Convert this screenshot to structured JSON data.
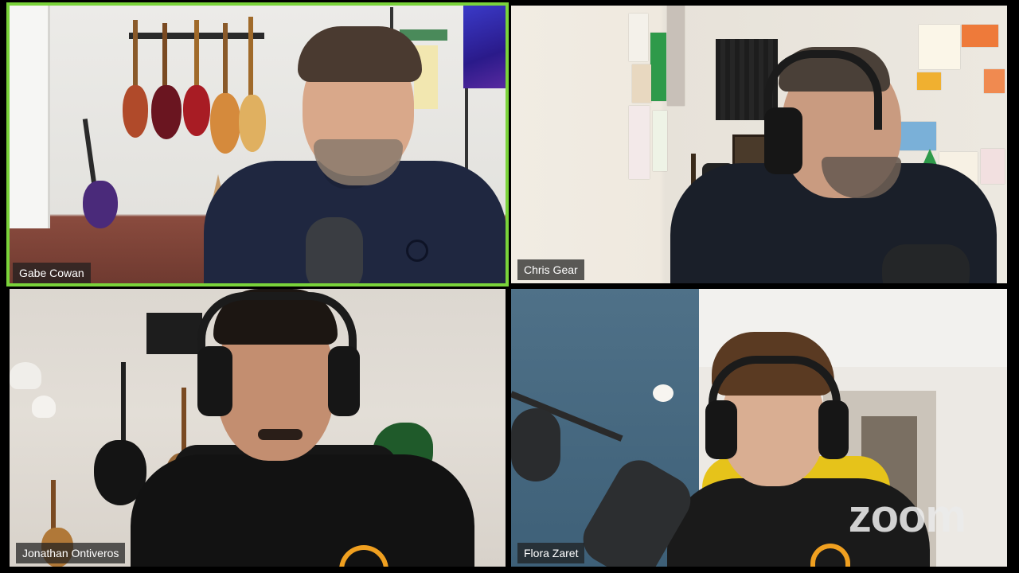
{
  "window": {
    "app": "zoom"
  },
  "participants": [
    {
      "name": "Gabe Cowan",
      "active_speaker": true
    },
    {
      "name": "Chris Gear",
      "active_speaker": false
    },
    {
      "name": "Jonathan Ontiveros",
      "active_speaker": false
    },
    {
      "name": "Flora Zaret",
      "active_speaker": false
    }
  ],
  "watermark": {
    "text": "zoom"
  },
  "colors": {
    "active_speaker_border": "#7ad33a",
    "background": "#000000",
    "name_tag_bg": "#1e1e1e",
    "name_tag_text": "#ffffff"
  },
  "icons": {
    "brand_logo_on_shirts": "audio-brand-logo-icon"
  }
}
